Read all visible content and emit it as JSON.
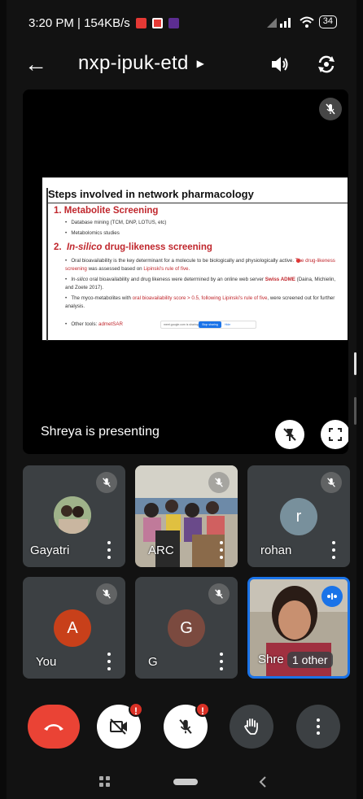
{
  "status_bar": {
    "time_speed": "3:20 PM | 154KB/s",
    "battery": "34"
  },
  "header": {
    "meeting_code": "nxp-ipuk-etd"
  },
  "slide": {
    "title": "Steps involved in network pharmacology",
    "sec1_title": "1.  Metabolite Screening",
    "sec1_b1": "Database mining (TCM, DNP, LOTUS, etc)",
    "sec1_b2": "Metabolomics studies",
    "sec2_num": "2.",
    "sec2_italic": "In-silico",
    "sec2_rest": " drug-likeness screening",
    "b1_a": "Oral bioavailability is the key determinant for a molecule to be biologically and physiologically active. ",
    "b1_r": "The drug-likeness screening",
    "b1_b": " was assessed based on ",
    "b1_r2": "Lipinski's rule of five.",
    "b2_a_it": "In-silico",
    "b2_a": " oral bioavailability and drug likeness were determined by an online web server ",
    "b2_rb": "Swiss ADME",
    "b2_b": " (Daina, Michielin, and Zoete 2017).",
    "b3_a": "The myco-metabolites with ",
    "b3_r": "oral bioavailability score > 0.5, following Lipinski's rule of five",
    "b3_b": ", were screened out for further analysis.",
    "b4_a": "Other tools: ",
    "b4_r": "admetSAR",
    "share_text": "meet.google.com is sharing your screen.",
    "share_stop": "Stop sharing",
    "share_hide": "Hide"
  },
  "presenting_label": "Shreya is presenting",
  "participants": [
    {
      "name": "Gayatri",
      "avatar": "photo"
    },
    {
      "name": "ARC",
      "avatar": "photo"
    },
    {
      "name": "rohan",
      "avatar": "r",
      "color": "#78909c"
    },
    {
      "name": "You",
      "avatar": "A",
      "color": "#c8401a"
    },
    {
      "name": "G",
      "avatar": "G",
      "color": "#7b4a3f"
    },
    {
      "name": "Shre",
      "other": "1 other",
      "avatar": "video"
    }
  ],
  "colors": {
    "end_call": "#ea4335",
    "alert": "#d93025",
    "tile": "#3c4043",
    "active_border": "#1a73e8",
    "slide_red": "#c0272d"
  }
}
